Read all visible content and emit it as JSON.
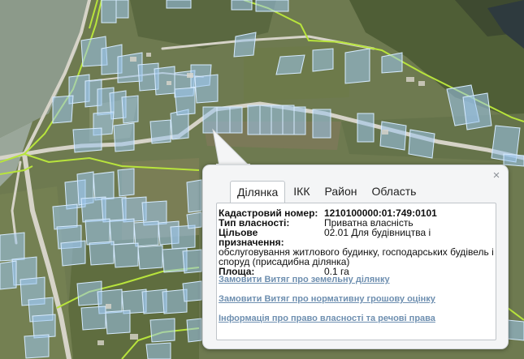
{
  "map": {
    "roads_color": "#d9d7cc",
    "parcel_fill": "#9cc6ee",
    "parcel_stroke": "#cfe5fb",
    "boundary_color": "#b7e43a"
  },
  "popup": {
    "close_glyph": "×",
    "tabs": [
      "Ділянка",
      "ІКК",
      "Район",
      "Область"
    ],
    "active_tab": "Ділянка",
    "fields": {
      "cadastral_label": "Кадастровий номер:",
      "cadastral_value": "1210100000:01:749:0101",
      "ownership_label": "Тип власності:",
      "ownership_value": "Приватна власність",
      "purpose_label": "Цільове призначення:",
      "purpose_value_1": "02.01 Для будівництва і",
      "purpose_value_2": "обслуговування житлового будинку, господарських будівель і",
      "purpose_value_3": "споруд (присадибна ділянка)",
      "area_label": "Площа:",
      "area_value": "0.1 га"
    },
    "links": [
      "Замовити Витяг про земельну ділянку",
      "Замовити Витяг про нормативну грошову оцінку",
      "Інформація про право власності та речові права"
    ]
  }
}
